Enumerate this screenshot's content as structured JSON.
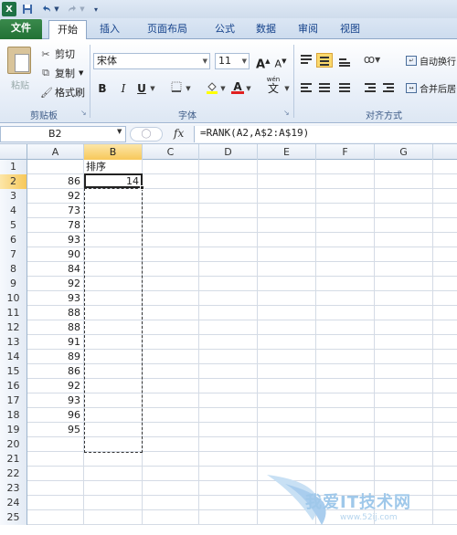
{
  "quick_access": {
    "logo": "X",
    "save_icon": "save-icon",
    "undo_icon": "undo-icon",
    "redo_icon": "redo-icon",
    "customize_icon": "customize-icon"
  },
  "tabs": [
    "文件",
    "开始",
    "插入",
    "页面布局",
    "公式",
    "数据",
    "审阅",
    "视图"
  ],
  "active_tab": "开始",
  "clipboard": {
    "paste_label": "粘贴",
    "cut_label": "剪切",
    "copy_label": "复制",
    "format_painter_label": "格式刷",
    "group_label": "剪贴板"
  },
  "font": {
    "font_name": "宋体",
    "font_size": "11",
    "grow_label": "A",
    "shrink_label": "A",
    "bold_label": "B",
    "italic_label": "I",
    "underline_label": "U",
    "color_label": "A",
    "phonetic_label": "wén",
    "phonetic_char": "文",
    "group_label": "字体"
  },
  "alignment": {
    "wrap_text_label": "自动换行",
    "merge_label": "合并后居",
    "group_label": "对齐方式"
  },
  "formula_bar": {
    "name_box": "B2",
    "fx_label": "fx",
    "formula": "=RANK(A2,A$2:A$19)"
  },
  "sheet": {
    "columns": [
      "A",
      "B",
      "C",
      "D",
      "E",
      "F",
      "G"
    ],
    "active_column": "B",
    "active_row": "2",
    "rows": [
      {
        "num": "1",
        "a": "",
        "b": "排序"
      },
      {
        "num": "2",
        "a": "86",
        "b": "14"
      },
      {
        "num": "3",
        "a": "92",
        "b": ""
      },
      {
        "num": "4",
        "a": "73",
        "b": ""
      },
      {
        "num": "5",
        "a": "78",
        "b": ""
      },
      {
        "num": "6",
        "a": "93",
        "b": ""
      },
      {
        "num": "7",
        "a": "90",
        "b": ""
      },
      {
        "num": "8",
        "a": "84",
        "b": ""
      },
      {
        "num": "9",
        "a": "92",
        "b": ""
      },
      {
        "num": "10",
        "a": "93",
        "b": ""
      },
      {
        "num": "11",
        "a": "88",
        "b": ""
      },
      {
        "num": "12",
        "a": "88",
        "b": ""
      },
      {
        "num": "13",
        "a": "91",
        "b": ""
      },
      {
        "num": "14",
        "a": "89",
        "b": ""
      },
      {
        "num": "15",
        "a": "86",
        "b": ""
      },
      {
        "num": "16",
        "a": "92",
        "b": ""
      },
      {
        "num": "17",
        "a": "93",
        "b": ""
      },
      {
        "num": "18",
        "a": "96",
        "b": ""
      },
      {
        "num": "19",
        "a": "95",
        "b": ""
      },
      {
        "num": "20",
        "a": "",
        "b": ""
      },
      {
        "num": "21",
        "a": "",
        "b": ""
      },
      {
        "num": "22",
        "a": "",
        "b": ""
      },
      {
        "num": "23",
        "a": "",
        "b": ""
      },
      {
        "num": "24",
        "a": "",
        "b": ""
      },
      {
        "num": "25",
        "a": "",
        "b": ""
      }
    ]
  },
  "watermark": {
    "text": "我爱IT技术网",
    "url": "www.52ij.com"
  },
  "colors": {
    "file_tab": "#227135",
    "active_header": "#f7c85a",
    "accent": "#15428b"
  }
}
